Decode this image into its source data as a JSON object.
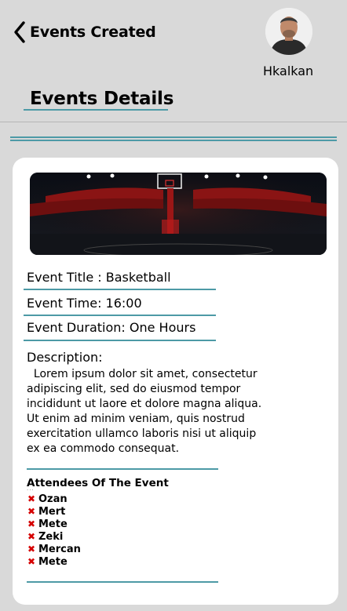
{
  "header": {
    "title": "Events Created",
    "username": "Hkalkan"
  },
  "page": {
    "title": "Events Details"
  },
  "event": {
    "title_line": "Event Title : Basketball",
    "time_line": "Event Time: 16:00",
    "duration_line": "Event Duration: One Hours",
    "description_heading": "Description:",
    "description_text": "  Lorem ipsum dolor sit amet, consectetur adipiscing elit, sed do eiusmod tempor incididunt ut laore et dolore magna aliqua. Ut enim ad minim veniam, quis nostrud exercitation ullamco laboris nisi ut aliquip ex ea commodo consequat."
  },
  "attendees": {
    "heading": "Attendees Of The Event",
    "list": [
      "Ozan",
      "Mert",
      "Mete",
      "Zeki",
      "Mercan",
      "Mete"
    ]
  },
  "icons": {
    "back": "chevron-left-icon",
    "remove": "x-icon"
  },
  "colors": {
    "accent": "#4d9aa6",
    "remove": "#d50000",
    "background": "#d9d9d9",
    "card": "#ffffff"
  }
}
